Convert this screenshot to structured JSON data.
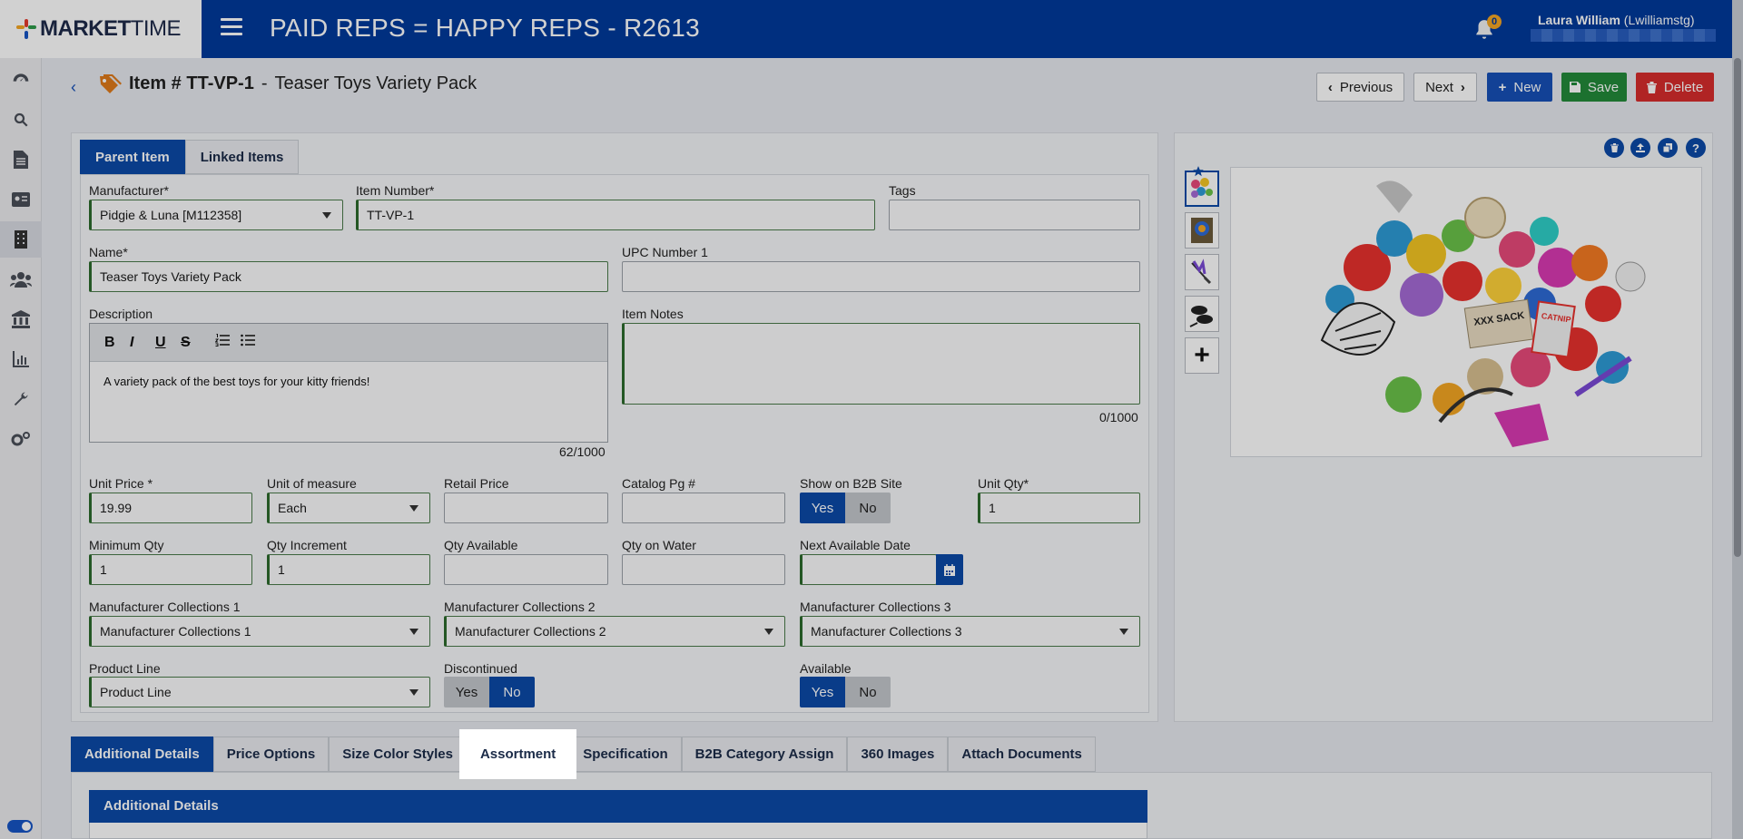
{
  "app": {
    "logo_bold": "MARKET",
    "logo_light": "TIME",
    "title": "PAID REPS = HAPPY REPS - R2613",
    "notification_count": "0",
    "user_name": "Laura William",
    "user_login": "(Lwilliamstg)"
  },
  "colors": {
    "brand": "#003a9c",
    "accent": "#0b4aa8",
    "save": "#238a3a",
    "delete": "#d72c2c",
    "required_border": "#2d6b2d"
  },
  "rail": [
    "dashboard-icon",
    "search-icon",
    "document-icon",
    "contact-card-icon",
    "building-icon",
    "users-icon",
    "bank-icon",
    "chart-icon",
    "wrench-icon",
    "settings-icon"
  ],
  "header": {
    "item_label": "Item # TT-VP-1",
    "separator": "-",
    "item_name": "Teaser Toys Variety Pack",
    "previous": "Previous",
    "next": "Next",
    "new": "New",
    "save": "Save",
    "delete": "Delete"
  },
  "form_tabs": [
    {
      "label": "Parent Item",
      "active": true
    },
    {
      "label": "Linked Items",
      "active": false
    }
  ],
  "form": {
    "manufacturer": {
      "label": "Manufacturer*",
      "value": "Pidgie & Luna [M112358]"
    },
    "item_number": {
      "label": "Item Number*",
      "value": "TT-VP-1"
    },
    "tags": {
      "label": "Tags",
      "value": ""
    },
    "name": {
      "label": "Name*",
      "value": "Teaser Toys Variety Pack"
    },
    "upc": {
      "label": "UPC Number 1",
      "value": ""
    },
    "description": {
      "label": "Description",
      "value": "A variety pack of the best toys for your kitty friends!",
      "counter": "62/1000"
    },
    "rte_buttons": [
      "B",
      "I",
      "U",
      "S"
    ],
    "item_notes": {
      "label": "Item Notes",
      "value": "",
      "counter": "0/1000"
    },
    "unit_price": {
      "label": "Unit Price *",
      "value": "19.99"
    },
    "unit_of_measure": {
      "label": "Unit of measure",
      "value": "Each"
    },
    "retail_price": {
      "label": "Retail Price",
      "value": ""
    },
    "catalog_pg": {
      "label": "Catalog Pg #",
      "value": ""
    },
    "show_b2b": {
      "label": "Show on B2B Site",
      "yes": "Yes",
      "no": "No",
      "selected": "Yes"
    },
    "unit_qty": {
      "label": "Unit Qty*",
      "value": "1"
    },
    "minimum_qty": {
      "label": "Minimum Qty",
      "value": "1"
    },
    "qty_increment": {
      "label": "Qty Increment",
      "value": "1"
    },
    "qty_available": {
      "label": "Qty Available",
      "value": ""
    },
    "qty_on_water": {
      "label": "Qty on Water",
      "value": ""
    },
    "next_available_date": {
      "label": "Next Available Date",
      "value": ""
    },
    "mc1": {
      "label": "Manufacturer Collections 1",
      "value": "Manufacturer Collections 1"
    },
    "mc2": {
      "label": "Manufacturer Collections 2",
      "value": "Manufacturer Collections 2"
    },
    "mc3": {
      "label": "Manufacturer Collections 3",
      "value": "Manufacturer Collections 3"
    },
    "product_line": {
      "label": "Product Line",
      "value": "Product Line"
    },
    "discontinued": {
      "label": "Discontinued",
      "yes": "Yes",
      "no": "No",
      "selected": "No"
    },
    "available": {
      "label": "Available",
      "yes": "Yes",
      "no": "No",
      "selected": "Yes"
    }
  },
  "image_tools": [
    "trash-icon",
    "upload-icon",
    "copy-icon",
    "help-icon"
  ],
  "product_image_text": {
    "sack": "XXX SACK",
    "catnip": "CATNIP"
  },
  "bottom_tabs": [
    {
      "label": "Additional Details",
      "active": true
    },
    {
      "label": "Price Options"
    },
    {
      "label": "Size Color Styles"
    },
    {
      "label": "Assortment",
      "highlighted": true
    },
    {
      "label": "Specification"
    },
    {
      "label": "B2B Category Assign"
    },
    {
      "label": "360 Images"
    },
    {
      "label": "Attach Documents"
    }
  ],
  "bottom_section_title": "Additional Details"
}
